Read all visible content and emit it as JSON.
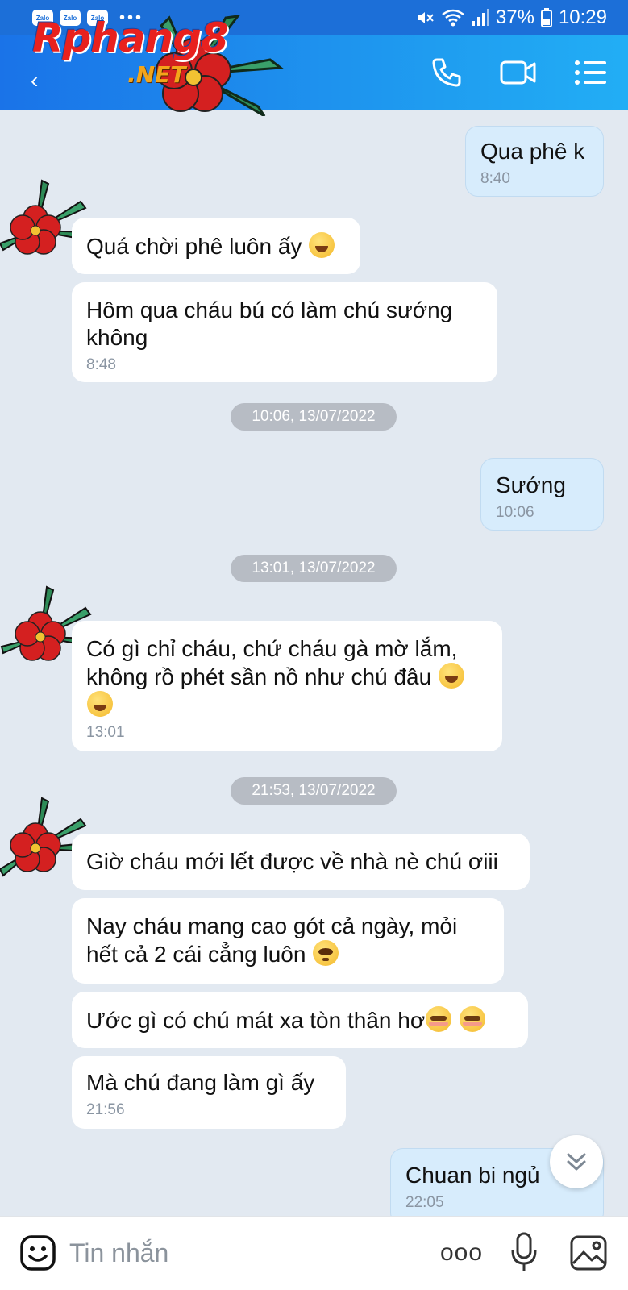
{
  "status_bar": {
    "notif_icons": [
      "Zalo",
      "Zalo",
      "Zalo"
    ],
    "overflow": "•••",
    "battery": "37%",
    "time": "10:29"
  },
  "header": {
    "logo_text": "Rphang8",
    "logo_sub": ".NET"
  },
  "messages": [
    {
      "dir": "out",
      "text": "Qua phê k",
      "time": "8:40"
    },
    {
      "dir": "in",
      "text": "Quá chời phê luôn ấy",
      "emoji": [
        "sweat-smile-emoji"
      ]
    },
    {
      "dir": "in",
      "text": "Hôm qua cháu bú có làm chú sướng không",
      "time": "8:48"
    },
    {
      "dir": "divider",
      "text": "10:06, 13/07/2022"
    },
    {
      "dir": "out",
      "text": "Sướng",
      "time": "10:06"
    },
    {
      "dir": "divider",
      "text": "13:01, 13/07/2022"
    },
    {
      "dir": "in",
      "text": "Có gì chỉ cháu, chứ cháu gà mờ lắm, không rồ phét sần nồ như chú đâu",
      "emoji": [
        "laughing-emoji",
        "laughing-emoji"
      ],
      "time": "13:01"
    },
    {
      "dir": "divider",
      "text": "21:53, 13/07/2022"
    },
    {
      "dir": "in",
      "text": "Giờ cháu mới lết được về nhà nè chú ơiii"
    },
    {
      "dir": "in",
      "text": "Nay cháu mang cao gót cả ngày, mỏi hết cả 2 cái cẳng luôn",
      "emoji": [
        "pleading-emoji"
      ]
    },
    {
      "dir": "in",
      "text": "Ước gì có chú mát xa tòn thân hơ",
      "emoji": [
        "blush-emoji",
        "blush-emoji"
      ]
    },
    {
      "dir": "in",
      "text": "Mà chú đang làm gì ấy",
      "time": "21:56"
    },
    {
      "dir": "out",
      "text": "Chuan bi ngủ",
      "time": "22:05"
    }
  ],
  "input": {
    "placeholder": "Tin nhắn",
    "more": "ooo"
  },
  "colors": {
    "header": "#1a73e8",
    "chat_bg": "#e2e9f1",
    "outgoing_bubble": "#d7ecfc",
    "incoming_bubble": "#ffffff",
    "divider_pill": "#b7bcc4"
  }
}
